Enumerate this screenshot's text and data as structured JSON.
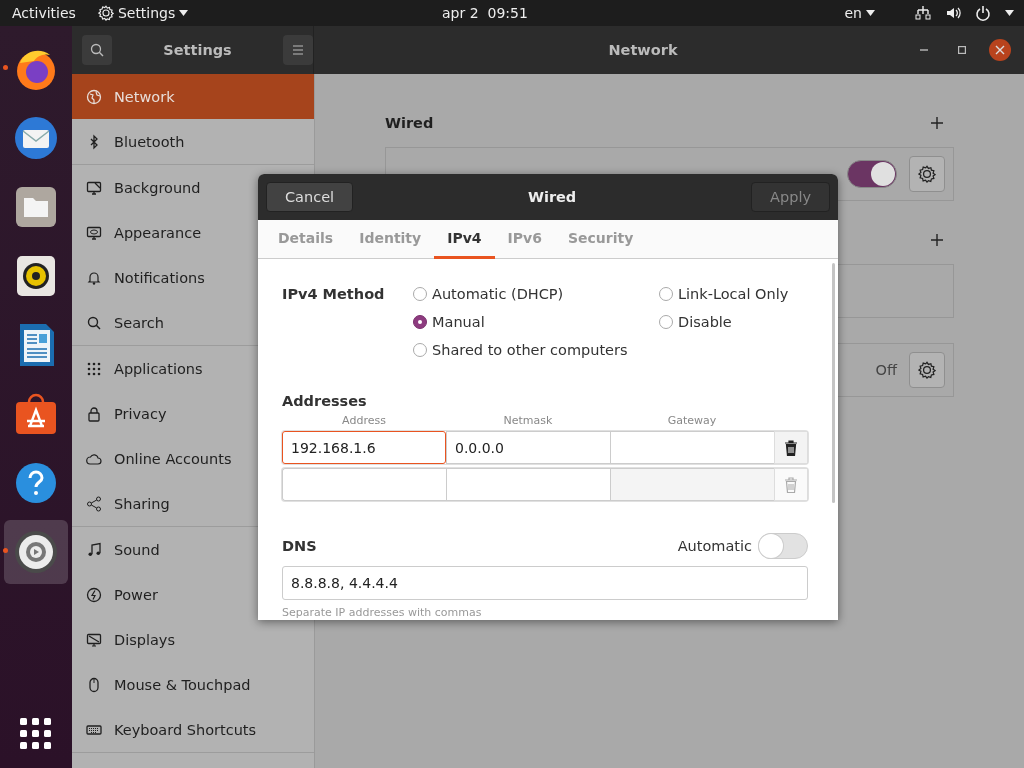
{
  "top_bar": {
    "activities": "Activities",
    "app_menu": "Settings",
    "clock": "apr 2  09:51",
    "keyboard_layout": "en"
  },
  "dock": {
    "items": [
      {
        "kind": "firefox",
        "running": true,
        "selected": false
      },
      {
        "kind": "mail",
        "running": false,
        "selected": false
      },
      {
        "kind": "files",
        "running": false,
        "selected": false
      },
      {
        "kind": "speaker",
        "running": false,
        "selected": false
      },
      {
        "kind": "document",
        "running": false,
        "selected": false
      },
      {
        "kind": "store",
        "running": false,
        "selected": false
      },
      {
        "kind": "help",
        "running": false,
        "selected": false
      },
      {
        "kind": "settings",
        "running": true,
        "selected": true
      }
    ]
  },
  "window": {
    "sidebar_title": "Settings",
    "title": "Network"
  },
  "sidebar": {
    "sections": [
      [
        {
          "label": "Network",
          "selected": true
        },
        {
          "label": "Bluetooth",
          "selected": false
        }
      ],
      [
        {
          "label": "Background",
          "selected": false
        },
        {
          "label": "Appearance",
          "selected": false
        },
        {
          "label": "Notifications",
          "selected": false
        },
        {
          "label": "Search",
          "selected": false
        }
      ],
      [
        {
          "label": "Applications",
          "selected": false
        },
        {
          "label": "Privacy",
          "selected": false
        },
        {
          "label": "Online Accounts",
          "selected": false
        },
        {
          "label": "Sharing",
          "selected": false
        }
      ],
      [
        {
          "label": "Sound",
          "selected": false
        },
        {
          "label": "Power",
          "selected": false
        },
        {
          "label": "Displays",
          "selected": false
        },
        {
          "label": "Mouse & Touchpad",
          "selected": false
        },
        {
          "label": "Keyboard Shortcuts",
          "selected": false
        }
      ]
    ]
  },
  "network": {
    "sections": [
      {
        "title": "Wired",
        "cards": [
          {
            "kind": "toggle",
            "on": true
          }
        ]
      },
      {
        "cards": [
          {
            "kind": "blank"
          },
          {
            "kind": "status",
            "value": "Off"
          }
        ]
      }
    ]
  },
  "dialog": {
    "title": "Wired",
    "cancel": "Cancel",
    "apply": {
      "label": "Apply",
      "disabled": true
    },
    "tabs": [
      {
        "label": "Details",
        "selected": false
      },
      {
        "label": "Identity",
        "selected": false
      },
      {
        "label": "IPv4",
        "selected": true
      },
      {
        "label": "IPv6",
        "selected": false
      },
      {
        "label": "Security",
        "selected": false
      }
    ],
    "method_label": "IPv4 Method",
    "methods": [
      {
        "label": "Automatic (DHCP)",
        "selected": false
      },
      {
        "label": "Link-Local Only",
        "selected": false
      },
      {
        "label": "Manual",
        "selected": true
      },
      {
        "label": "Disable",
        "selected": false
      },
      {
        "label": "Shared to other computers",
        "selected": false
      }
    ],
    "addresses": {
      "title": "Addresses",
      "columns": [
        "Address",
        "Netmask",
        "Gateway"
      ],
      "rows": [
        {
          "cells": [
            "192.168.1.6",
            "0.0.0.0"
          ],
          "focused": true,
          "disabled": false
        },
        {
          "cells": [],
          "focused": false,
          "disabled": true
        }
      ]
    },
    "dns": {
      "title": "DNS",
      "automatic_label": "Automatic",
      "automatic": false,
      "value": "8.8.8.8, 4.4.4.4",
      "hint": "Separate IP addresses with commas"
    }
  }
}
